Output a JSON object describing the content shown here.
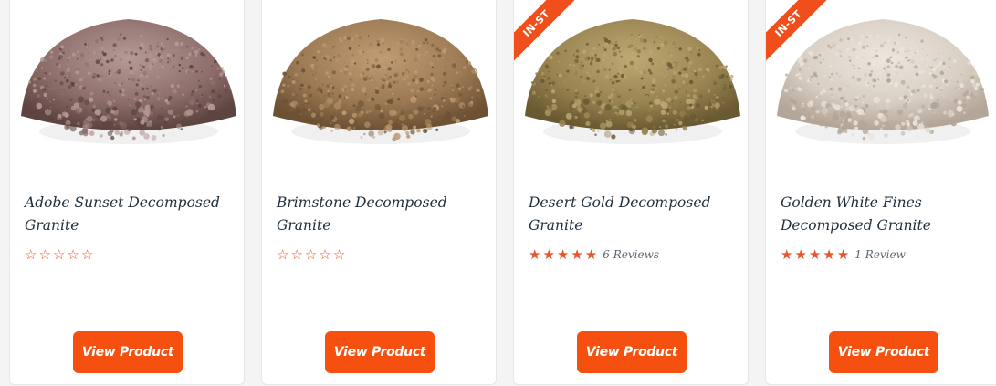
{
  "products": [
    {
      "title": "Adobe Sunset Decomposed Granite",
      "rating": 0,
      "reviews": "",
      "badge": "",
      "button": "View Product",
      "image": "adobe-sunset-gravel-pile",
      "colors": {
        "base": "#8f6f6b",
        "light": "#b59a96",
        "dark": "#5d4440"
      }
    },
    {
      "title": "Brimstone Decomposed Granite",
      "rating": 0,
      "reviews": "",
      "badge": "",
      "button": "View Product",
      "image": "brimstone-gravel-pile",
      "colors": {
        "base": "#9c7a55",
        "light": "#c09c72",
        "dark": "#6c5133"
      }
    },
    {
      "title": "Desert Gold Decomposed Granite",
      "rating": 5,
      "reviews": "6 Reviews",
      "badge": "IN-ST",
      "button": "View Product",
      "image": "desert-gold-gravel-pile",
      "colors": {
        "base": "#9a8552",
        "light": "#bea874",
        "dark": "#6a5a32"
      }
    },
    {
      "title": "Golden White Fines Decomposed Granite",
      "rating": 5,
      "reviews": "1 Review",
      "badge": "IN-ST",
      "button": "View Product",
      "image": "golden-white-fines-pile",
      "colors": {
        "base": "#d9cfc4",
        "light": "#ede6de",
        "dark": "#b3a597"
      }
    }
  ],
  "theme": {
    "accent": "#f5500f",
    "star": "#e8542b",
    "title": "#1e2d3b"
  }
}
